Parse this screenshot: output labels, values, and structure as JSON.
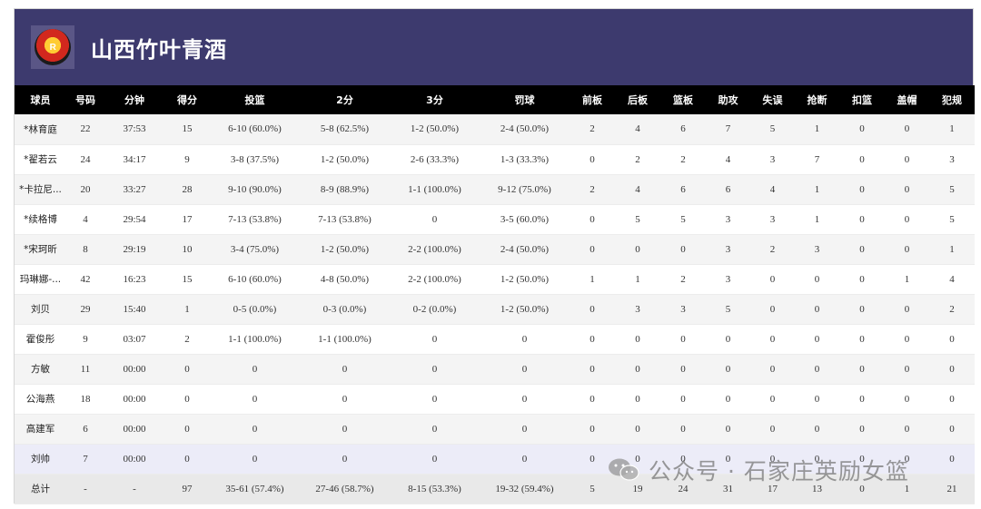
{
  "team": {
    "name": "山西竹叶青酒",
    "logo_text": "R"
  },
  "columns": [
    "球员",
    "号码",
    "分钟",
    "得分",
    "投篮",
    "2分",
    "3分",
    "罚球",
    "前板",
    "后板",
    "篮板",
    "助攻",
    "失误",
    "抢断",
    "扣篮",
    "盖帽",
    "犯规"
  ],
  "rows": [
    [
      "*林育庭",
      "22",
      "37:53",
      "15",
      "6-10 (60.0%)",
      "5-8 (62.5%)",
      "1-2 (50.0%)",
      "2-4 (50.0%)",
      "2",
      "4",
      "6",
      "7",
      "5",
      "1",
      "0",
      "0",
      "1"
    ],
    [
      "*翟若云",
      "24",
      "34:17",
      "9",
      "3-8 (37.5%)",
      "1-2 (50.0%)",
      "2-6 (33.3%)",
      "1-3 (33.3%)",
      "0",
      "2",
      "2",
      "4",
      "3",
      "7",
      "0",
      "0",
      "3"
    ],
    [
      "*卡拉尼...",
      "20",
      "33:27",
      "28",
      "9-10 (90.0%)",
      "8-9 (88.9%)",
      "1-1 (100.0%)",
      "9-12 (75.0%)",
      "2",
      "4",
      "6",
      "6",
      "4",
      "1",
      "0",
      "0",
      "5"
    ],
    [
      "*续格博",
      "4",
      "29:54",
      "17",
      "7-13 (53.8%)",
      "7-13 (53.8%)",
      "0",
      "3-5 (60.0%)",
      "0",
      "5",
      "5",
      "3",
      "3",
      "1",
      "0",
      "0",
      "5"
    ],
    [
      "*宋珂昕",
      "8",
      "29:19",
      "10",
      "3-4 (75.0%)",
      "1-2 (50.0%)",
      "2-2 (100.0%)",
      "2-4 (50.0%)",
      "0",
      "0",
      "0",
      "3",
      "2",
      "3",
      "0",
      "0",
      "1"
    ],
    [
      "玛琳娜-...",
      "42",
      "16:23",
      "15",
      "6-10 (60.0%)",
      "4-8 (50.0%)",
      "2-2 (100.0%)",
      "1-2 (50.0%)",
      "1",
      "1",
      "2",
      "3",
      "0",
      "0",
      "0",
      "1",
      "4"
    ],
    [
      "刘贝",
      "29",
      "15:40",
      "1",
      "0-5 (0.0%)",
      "0-3 (0.0%)",
      "0-2 (0.0%)",
      "1-2 (50.0%)",
      "0",
      "3",
      "3",
      "5",
      "0",
      "0",
      "0",
      "0",
      "2"
    ],
    [
      "霍俊彤",
      "9",
      "03:07",
      "2",
      "1-1 (100.0%)",
      "1-1 (100.0%)",
      "0",
      "0",
      "0",
      "0",
      "0",
      "0",
      "0",
      "0",
      "0",
      "0",
      "0"
    ],
    [
      "方敏",
      "11",
      "00:00",
      "0",
      "0",
      "0",
      "0",
      "0",
      "0",
      "0",
      "0",
      "0",
      "0",
      "0",
      "0",
      "0",
      "0"
    ],
    [
      "公海燕",
      "18",
      "00:00",
      "0",
      "0",
      "0",
      "0",
      "0",
      "0",
      "0",
      "0",
      "0",
      "0",
      "0",
      "0",
      "0",
      "0"
    ],
    [
      "高建军",
      "6",
      "00:00",
      "0",
      "0",
      "0",
      "0",
      "0",
      "0",
      "0",
      "0",
      "0",
      "0",
      "0",
      "0",
      "0",
      "0"
    ],
    [
      "刘帅",
      "7",
      "00:00",
      "0",
      "0",
      "0",
      "0",
      "0",
      "0",
      "0",
      "0",
      "0",
      "0",
      "0",
      "0",
      "0",
      "0"
    ],
    [
      "总计",
      "-",
      "-",
      "97",
      "35-61 (57.4%)",
      "27-46 (58.7%)",
      "8-15 (53.3%)",
      "19-32 (59.4%)",
      "5",
      "19",
      "24",
      "31",
      "17",
      "13",
      "0",
      "1",
      "21"
    ]
  ],
  "watermark": {
    "text": "公众号 · 石家庄英励女篮",
    "icon": "wechat-icon"
  },
  "colors": {
    "header_bg": "#3d3a6e",
    "table_head_bg": "#000000"
  }
}
